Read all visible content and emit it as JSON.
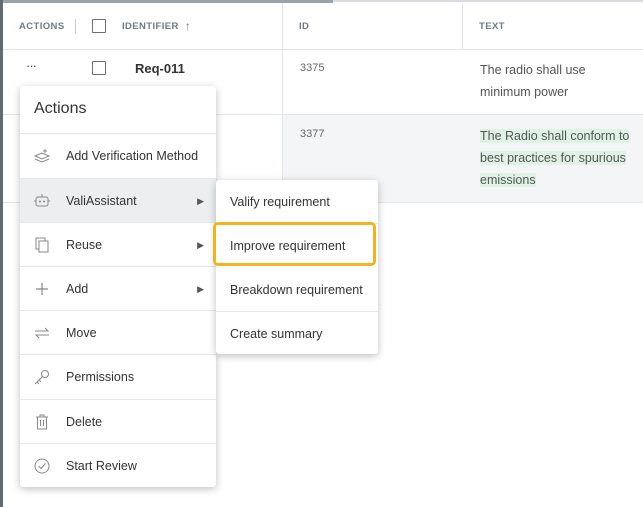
{
  "table": {
    "headers": {
      "actions": "ACTIONS",
      "identifier": "IDENTIFIER",
      "id": "ID",
      "text": "TEXT"
    },
    "sort_indicator": "↑",
    "rows": [
      {
        "actions_label": "···",
        "identifier": "Req-011",
        "id": "3375",
        "text": "The radio shall use minimum power"
      },
      {
        "id": "3377",
        "text": "The Radio shall conform to best practices for spurious emissions"
      }
    ]
  },
  "actions_menu": {
    "title": "Actions",
    "items": [
      {
        "label": "Add Verification Method",
        "icon": "verification-layers-icon",
        "submenu": false
      },
      {
        "label": "ValiAssistant",
        "icon": "robot-icon",
        "submenu": true
      },
      {
        "label": "Reuse",
        "icon": "copy-icon",
        "submenu": true
      },
      {
        "label": "Add",
        "icon": "plus-icon",
        "submenu": true
      },
      {
        "label": "Move",
        "icon": "move-arrows-icon",
        "submenu": false
      },
      {
        "label": "Permissions",
        "icon": "key-icon",
        "submenu": false
      },
      {
        "label": "Delete",
        "icon": "trash-icon",
        "submenu": false
      },
      {
        "label": "Start Review",
        "icon": "check-circle-icon",
        "submenu": false
      }
    ],
    "submenu_caret": "▶"
  },
  "vali_submenu": {
    "items": [
      {
        "label": "Valify requirement"
      },
      {
        "label": "Improve requirement",
        "highlighted": true
      },
      {
        "label": "Breakdown requirement"
      },
      {
        "label": "Create summary"
      }
    ]
  },
  "colors": {
    "highlight_border": "#f0b41e",
    "text_highlight": "#dff2e6",
    "active_menu_bg": "#eceeef"
  }
}
